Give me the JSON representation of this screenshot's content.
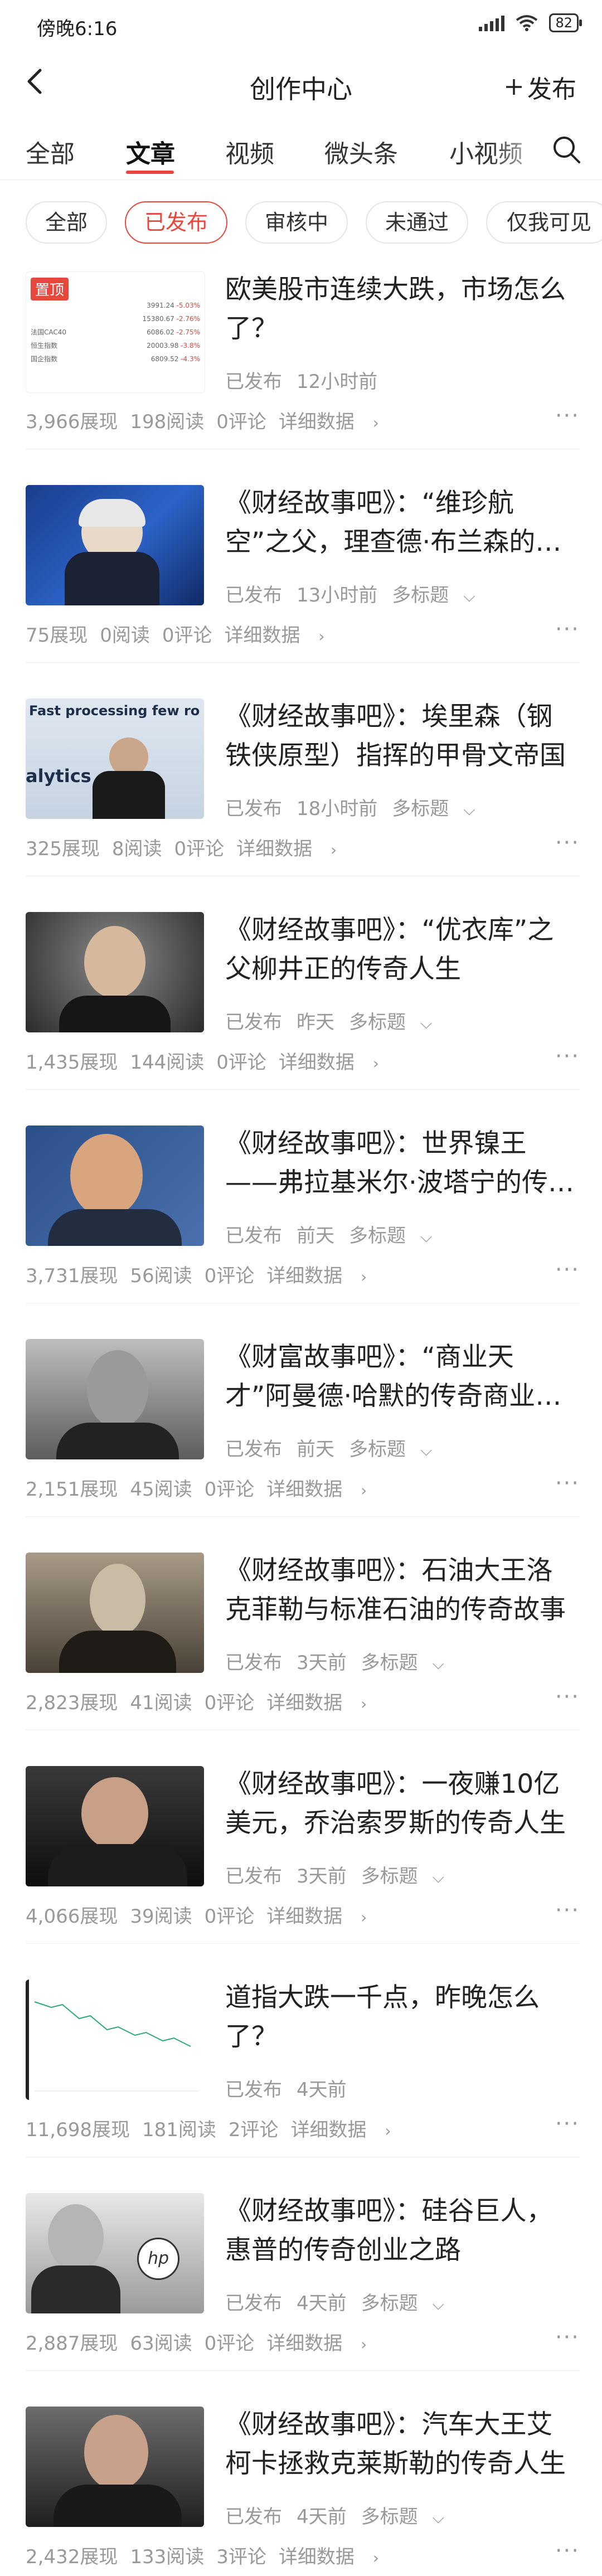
{
  "status_bar": {
    "time": "傍晚6:16",
    "battery": "82"
  },
  "header": {
    "title": "创作中心",
    "publish_label": "发布"
  },
  "tabs": [
    {
      "label": "全部"
    },
    {
      "label": "文章"
    },
    {
      "label": "视频"
    },
    {
      "label": "微头条"
    },
    {
      "label": "小视频"
    }
  ],
  "filters": [
    {
      "label": "全部"
    },
    {
      "label": "已发布"
    },
    {
      "label": "审核中"
    },
    {
      "label": "未通过"
    },
    {
      "label": "仅我可见"
    }
  ],
  "colors": {
    "accent": "#e8473c",
    "muted": "#999999",
    "text": "#222222"
  },
  "pin_label": "置顶",
  "stock_rows": [
    {
      "name": "",
      "v": "3991.24",
      "p": "-5.03%"
    },
    {
      "name": "",
      "v": "15380.67",
      "p": "-2.76%"
    },
    {
      "name": "法国CAC40",
      "v": "6086.02",
      "p": "-2.75%"
    },
    {
      "name": "",
      "v": "",
      "p": ""
    },
    {
      "name": "恒生指数",
      "v": "20003.98",
      "p": "-3.8%"
    },
    {
      "name": "国企指数",
      "v": "6809.52",
      "p": "-4.3%"
    }
  ],
  "articles": [
    {
      "title": "欧美股市连续大跌，市场怎么了？",
      "status": "已发布",
      "time": "12小时前",
      "extra": "",
      "views": "3,966展现",
      "reads": "198阅读",
      "comments": "0评论",
      "detail": "详细数据"
    },
    {
      "title": "《财经故事吧》：“维珍航空”之父，理查德·布兰森的传奇人生",
      "status": "已发布",
      "time": "13小时前",
      "extra": "多标题",
      "views": "75展现",
      "reads": "0阅读",
      "comments": "0评论",
      "detail": "详细数据"
    },
    {
      "title": "《财经故事吧》：埃里森（钢铁侠原型）指挥的甲骨文帝国",
      "status": "已发布",
      "time": "18小时前",
      "extra": "多标题",
      "views": "325展现",
      "reads": "8阅读",
      "comments": "0评论",
      "detail": "详细数据"
    },
    {
      "title": "《财经故事吧》：“优衣库”之父柳井正的传奇人生",
      "status": "已发布",
      "time": "昨天",
      "extra": "多标题",
      "views": "1,435展现",
      "reads": "144阅读",
      "comments": "0评论",
      "detail": "详细数据"
    },
    {
      "title": "《财经故事吧》：世界镍王——弗拉基米尔·波塔宁的传奇人生",
      "status": "已发布",
      "time": "前天",
      "extra": "多标题",
      "views": "3,731展现",
      "reads": "56阅读",
      "comments": "0评论",
      "detail": "详细数据"
    },
    {
      "title": "《财富故事吧》：“商业天才”阿曼德·哈默的传奇商业人生",
      "status": "已发布",
      "time": "前天",
      "extra": "多标题",
      "views": "2,151展现",
      "reads": "45阅读",
      "comments": "0评论",
      "detail": "详细数据"
    },
    {
      "title": "《财经故事吧》：石油大王洛克菲勒与标准石油的传奇故事",
      "status": "已发布",
      "time": "3天前",
      "extra": "多标题",
      "views": "2,823展现",
      "reads": "41阅读",
      "comments": "0评论",
      "detail": "详细数据"
    },
    {
      "title": "《财经故事吧》：一夜赚10亿美元，乔治索罗斯的传奇人生",
      "status": "已发布",
      "time": "3天前",
      "extra": "多标题",
      "views": "4,066展现",
      "reads": "39阅读",
      "comments": "0评论",
      "detail": "详细数据"
    },
    {
      "title": "道指大跌一千点，昨晚怎么了？",
      "status": "已发布",
      "time": "4天前",
      "extra": "",
      "views": "11,698展现",
      "reads": "181阅读",
      "comments": "2评论",
      "detail": "详细数据"
    },
    {
      "title": "《财经故事吧》：硅谷巨人，惠普的传奇创业之路",
      "status": "已发布",
      "time": "4天前",
      "extra": "多标题",
      "views": "2,887展现",
      "reads": "63阅读",
      "comments": "0评论",
      "detail": "详细数据"
    },
    {
      "title": "《财经故事吧》：汽车大王艾柯卡拯救克莱斯勒的传奇人生",
      "status": "已发布",
      "time": "4天前",
      "extra": "多标题",
      "views": "2,432展现",
      "reads": "133阅读",
      "comments": "3评论",
      "detail": "详细数据"
    }
  ],
  "thumb_captions": {
    "a3": "Fast processing few ro",
    "a3b": "alytics",
    "a10": "hp"
  }
}
